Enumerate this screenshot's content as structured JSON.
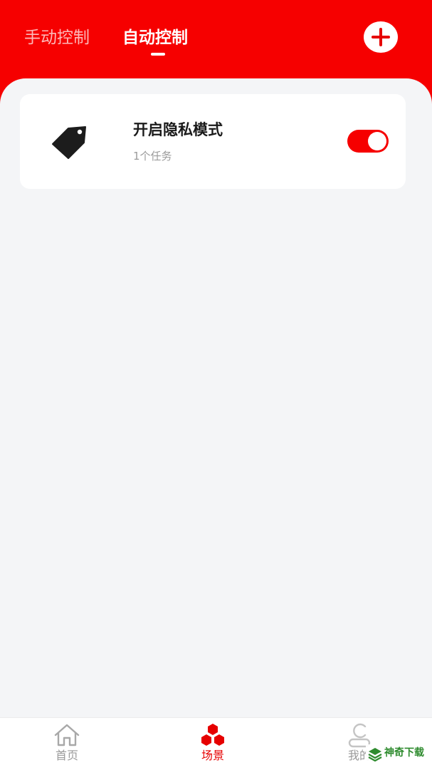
{
  "header": {
    "tabs": [
      {
        "label": "手动控制",
        "active": false
      },
      {
        "label": "自动控制",
        "active": true
      }
    ],
    "add_icon": "plus-icon"
  },
  "scenes": [
    {
      "icon": "tag-icon",
      "title": "开启隐私模式",
      "subtitle": "1个任务",
      "enabled": true
    }
  ],
  "bottom_nav": {
    "items": [
      {
        "label": "首页",
        "icon": "home-icon",
        "active": false
      },
      {
        "label": "场景",
        "icon": "hexagon-cluster-icon",
        "active": true
      },
      {
        "label": "我的",
        "icon": "user-icon",
        "active": false
      }
    ]
  },
  "watermark": {
    "text": "神奇下载",
    "icon": "watermark-logo-icon"
  },
  "colors": {
    "brand_red": "#f60000",
    "background": "#f4f5f7",
    "card": "#ffffff",
    "muted_text": "#9b9b9b"
  }
}
